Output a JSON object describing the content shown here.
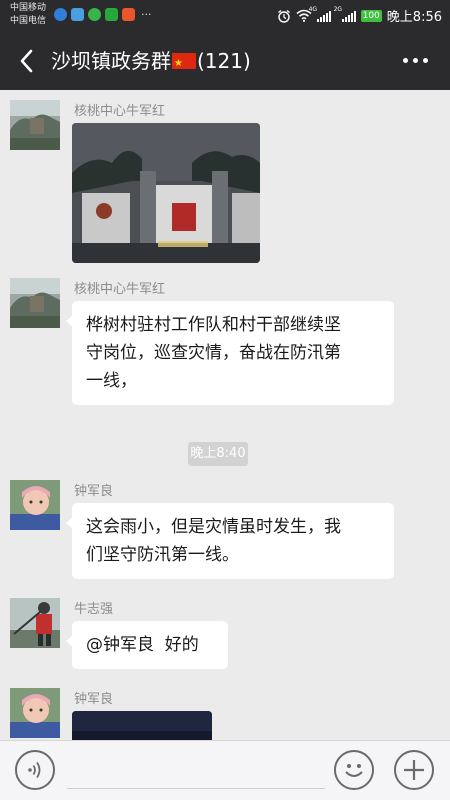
{
  "status_bar": {
    "carrier_1": "中国移动",
    "carrier_2": "中国电信",
    "network_1": "4G",
    "network_2": "2G",
    "battery": "100",
    "time": "晚上8:56",
    "more": "···"
  },
  "header": {
    "title_prefix": "沙坝镇政务群",
    "title_suffix": "(121)",
    "flag_icon": "china-flag-icon"
  },
  "messages": [
    {
      "sender": "核桃中心牛军红",
      "type": "image",
      "image_desc": "village-gate-night-photo"
    },
    {
      "sender": "核桃中心牛军红",
      "type": "text",
      "lines": [
        "桦树村驻村工作队和村干部继续坚",
        "守岗位，巡查灾情，奋战在防汛第",
        "一线，"
      ]
    },
    {
      "type": "time",
      "text": "晚上8:40"
    },
    {
      "sender": "钟军良",
      "type": "text",
      "lines": [
        "这会雨小，但是灾情虽时发生，我",
        "们坚守防汛第一线。"
      ]
    },
    {
      "sender": "牛志强",
      "type": "text",
      "lines": [
        "@钟军良  好的"
      ]
    },
    {
      "sender": "钟军良",
      "type": "image",
      "image_desc": "dark-night-photo"
    }
  ],
  "input_bar": {
    "voice_icon": "voice-icon",
    "emoji_icon": "emoji-icon",
    "plus_icon": "plus-icon"
  },
  "colors": {
    "header_bg": "#2b2b2d",
    "chat_bg": "#ebebeb",
    "bubble_bg": "#ffffff",
    "time_chip_bg": "#d2d2d2",
    "battery": "#3fc13f"
  }
}
